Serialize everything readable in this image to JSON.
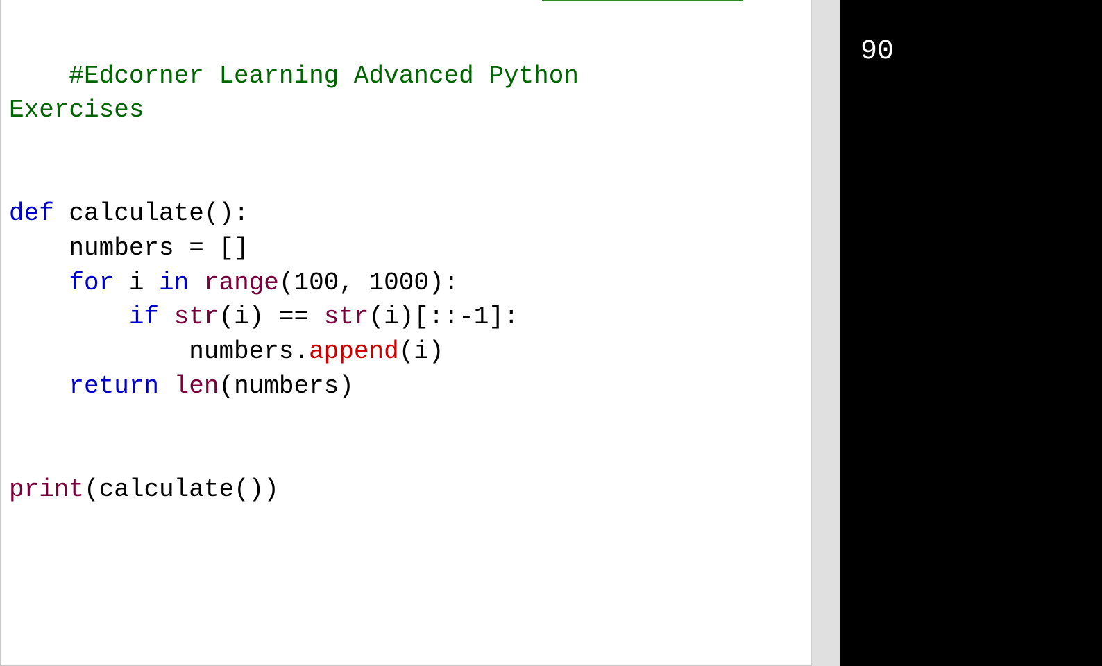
{
  "code": {
    "comment_line1": "#Edcorner Learning Advanced Python",
    "comment_line2": "Exercises",
    "kw_def": "def",
    "fn_name": " calculate():",
    "line_numbers": "    numbers = []",
    "kw_for": "    for",
    "for_var": " i ",
    "kw_in": "in",
    "space1": " ",
    "range_fn": "range",
    "range_args": "(100, 1000):",
    "kw_if": "        if",
    "space2": " ",
    "str_fn1": "str",
    "str_arg1": "(i) == ",
    "str_fn2": "str",
    "str_arg2": "(i)[::-1]:",
    "append_pre": "            numbers.",
    "append_fn": "append",
    "append_arg": "(i)",
    "kw_return": "    return",
    "space3": " ",
    "len_fn": "len",
    "len_arg": "(numbers)",
    "print_fn": "print",
    "print_arg": "(calculate())"
  },
  "output": {
    "result": "90"
  }
}
